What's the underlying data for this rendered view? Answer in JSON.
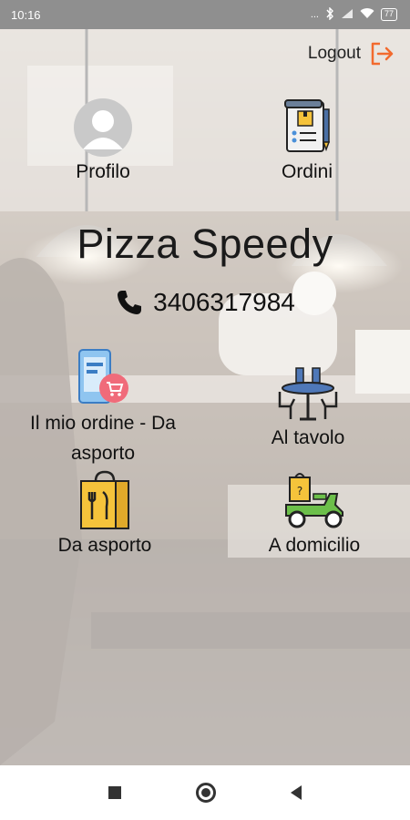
{
  "status_bar": {
    "time": "10:16",
    "signal_text": "...",
    "battery_level": "77",
    "icons": [
      "bluetooth-icon",
      "signal-icon",
      "wifi-icon",
      "battery-icon"
    ]
  },
  "header": {
    "logout_label": "Logout",
    "logout_icon": "logout-icon",
    "accent_color": "#f26a2e"
  },
  "menu": {
    "profile_label": "Profilo",
    "orders_label": "Ordini"
  },
  "restaurant": {
    "name": "Pizza Speedy",
    "phone": "3406317984"
  },
  "options": {
    "my_order_label": "Il mio ordine - Da asporto",
    "table_label": "Al tavolo",
    "takeaway_label": "Da asporto",
    "delivery_label": "A domicilio"
  },
  "navigation": {
    "icons": [
      "recent-apps-icon",
      "home-icon",
      "back-icon"
    ]
  }
}
